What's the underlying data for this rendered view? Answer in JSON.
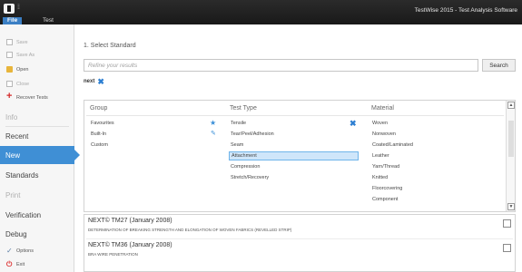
{
  "window": {
    "title": "TestWise 2015 - Test Analysis Software",
    "qa_glyph": "⁞⁞"
  },
  "menu": {
    "file": "File",
    "test": "Test"
  },
  "sidebar": {
    "save": "Save",
    "save_as": "Save As",
    "open": "Open",
    "close": "Close",
    "recover": "Recover Tests",
    "info": "Info",
    "recent": "Recent",
    "new": "New",
    "standards": "Standards",
    "print": "Print",
    "verification": "Verification",
    "debug": "Debug",
    "options": "Options",
    "exit": "Exit"
  },
  "main": {
    "section_title": "1. Select Standard",
    "refine_placeholder": "Refine your results",
    "search_label": "Search",
    "active_filter": "next",
    "icons": {
      "clear_filter": "close-icon",
      "favourites": "star-icon",
      "built_in": "pin-icon",
      "clear_type": "close-icon"
    },
    "columns": {
      "group": "Group",
      "test_type": "Test Type",
      "material": "Material"
    },
    "groups": [
      "Favourites",
      "Built-In",
      "Custom"
    ],
    "test_types": [
      "Tensile",
      "Tear/Peel/Adhesion",
      "Seam",
      "Attachment",
      "Compression",
      "Stretch/Recovery"
    ],
    "selected_test_type": "Attachment",
    "materials": [
      "Woven",
      "Nonwoven",
      "Coated/Laminated",
      "Leather",
      "Yarn/Thread",
      "Knitted",
      "Floorcovering",
      "Component"
    ],
    "scroll_up_glyph": "▲",
    "scroll_down_glyph": "▼",
    "results": [
      {
        "title": "NEXT© TM27 (January 2008)",
        "description": "DETERMINATION OF BREAKING STRENGTH AND ELONGATION OF WOVEN FABRICS (REVELLED STRIP)",
        "checked": false
      },
      {
        "title": "NEXT© TM36 (January 2008)",
        "description": "BRA WIRE PENETRATION",
        "checked": false
      }
    ]
  },
  "colors": {
    "accent": "#3f8fd5",
    "titlebar": "#1f1f1f",
    "selection": "#cfe6fa",
    "recover_icon": "#d42a2a"
  }
}
